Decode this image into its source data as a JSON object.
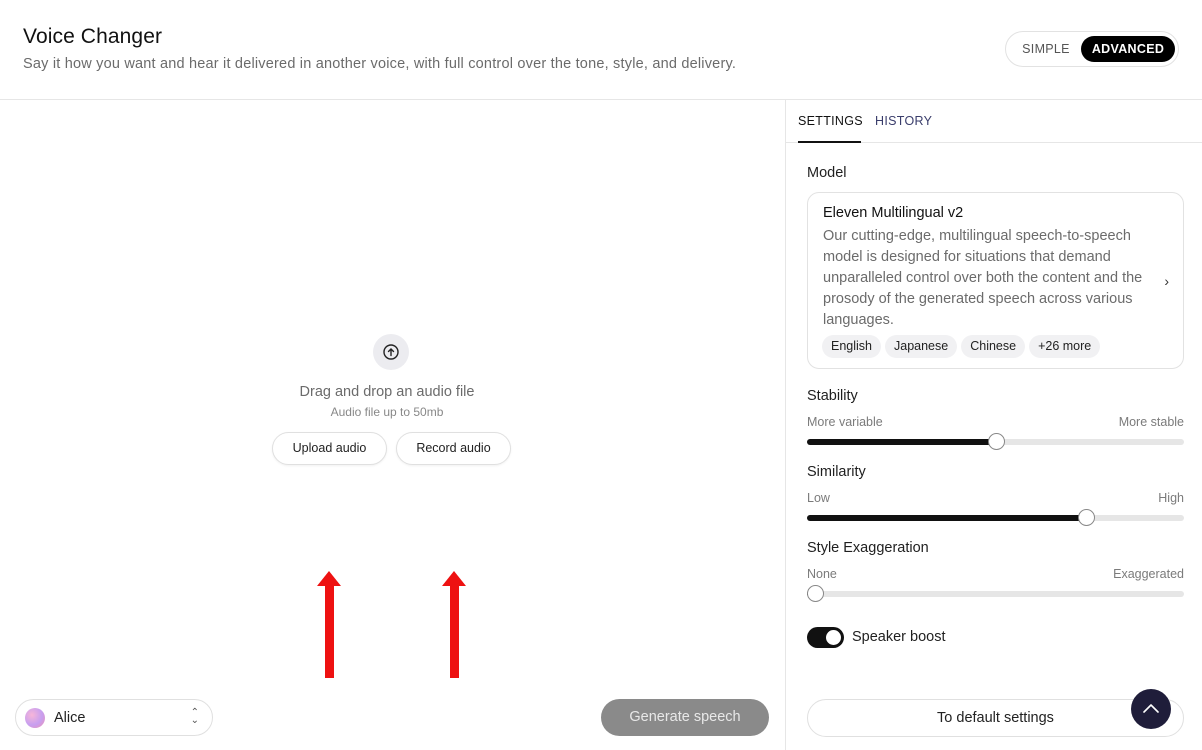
{
  "header": {
    "title": "Voice Changer",
    "subtitle": "Say it how you want and hear it delivered in another voice, with full control over the tone, style, and delivery.",
    "modes": {
      "simple": "SIMPLE",
      "advanced": "ADVANCED",
      "selected": "ADVANCED"
    }
  },
  "main": {
    "drop_text": "Drag and drop an audio file",
    "drop_subtext": "Audio file up to 50mb",
    "upload_button": "Upload audio",
    "record_button": "Record audio",
    "voice": "Alice",
    "generate_button": "Generate speech"
  },
  "panel": {
    "tabs": [
      "SETTINGS",
      "HISTORY"
    ],
    "active_tab": "SETTINGS",
    "model_label": "Model",
    "model": {
      "name": "Eleven Multilingual v2",
      "description": "Our cutting-edge, multilingual speech-to-speech model is designed for situations that demand unparalleled control over both the content and the prosody of the generated speech across various languages.",
      "languages": [
        "English",
        "Japanese",
        "Chinese",
        "+26 more"
      ]
    },
    "stability": {
      "label": "Stability",
      "min_label": "More variable",
      "max_label": "More stable",
      "value": 0.5
    },
    "similarity": {
      "label": "Similarity",
      "min_label": "Low",
      "max_label": "High",
      "value": 0.74
    },
    "style": {
      "label": "Style Exaggeration",
      "min_label": "None",
      "max_label": "Exaggerated",
      "value": 0.02
    },
    "speaker_boost": {
      "label": "Speaker boost",
      "enabled": true
    },
    "default_button": "To default settings"
  },
  "colors": {
    "accent": "#000000",
    "annotation_arrow": "#ee1111",
    "generate_disabled": "#8a8a8a",
    "fab": "#1f1d3a"
  },
  "icons": [
    "upload-icon",
    "chevron-updown-icon",
    "chevron-right-icon",
    "arrow-up-icon",
    "red-arrow"
  ]
}
